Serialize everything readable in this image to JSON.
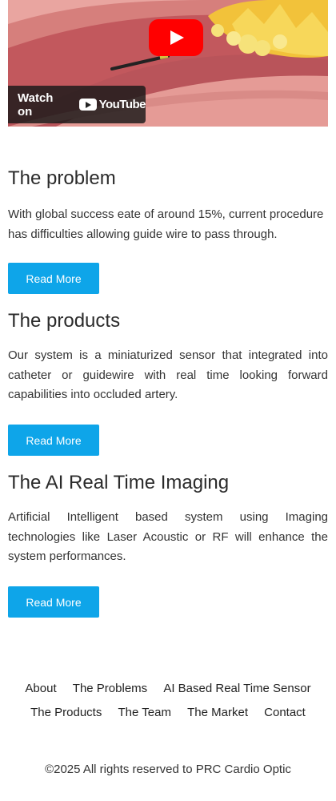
{
  "video": {
    "watch_label": "Watch on",
    "youtube_label": "YouTube"
  },
  "sections": [
    {
      "title": "The problem",
      "text": "With global success eate of around 15%, current procedure has difficulties allowing guide wire to pass through.",
      "button": "Read More"
    },
    {
      "title": "The products",
      "text": "Our system is a miniaturized sensor that integrated into catheter or guidewire with real time looking forward capabilities into occluded artery.",
      "button": "Read More"
    },
    {
      "title": "The AI Real Time Imaging",
      "text": "Artificial Intelligent based system using Imaging technologies like Laser Acoustic or RF will enhance the system performances.",
      "button": "Read More"
    }
  ],
  "footer": {
    "row1": [
      "About",
      "The Problems",
      "AI Based Real Time Sensor"
    ],
    "row2": [
      "The Products",
      "The Team",
      "The Market",
      "Contact"
    ],
    "copyright": "©2025 All rights reserved to PRC Cardio Optic"
  },
  "colors": {
    "button": "#0ea5e9",
    "youtube_red": "#ff0000"
  }
}
